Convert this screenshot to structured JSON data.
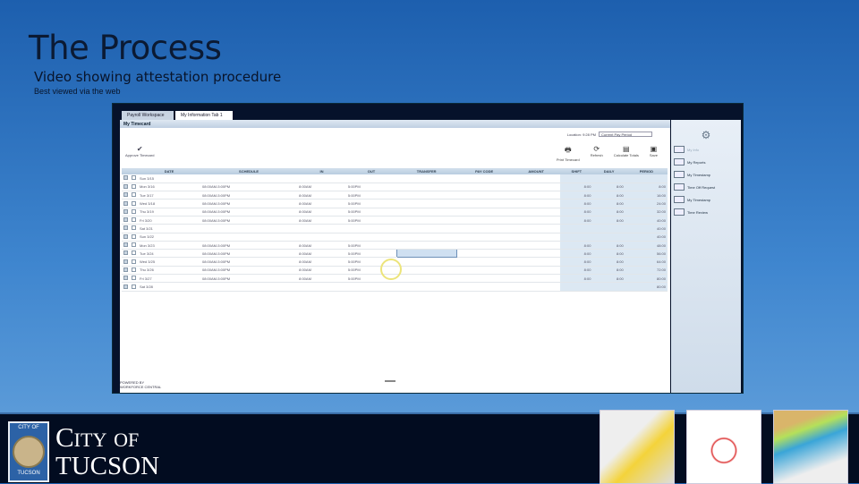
{
  "slide": {
    "title": "The Process",
    "subtitle": "Video showing attestation procedure",
    "note": "Best viewed via the web"
  },
  "app": {
    "tabs": [
      "Payroll Workspace",
      "My Information"
    ],
    "tab_close": "Tab 1",
    "header": "My Timecard",
    "location_label": "Location: 9:28 PM",
    "period_select": "Current Pay Period",
    "approve_label": "Approve Timecard",
    "tools": [
      {
        "icon": "print-icon",
        "label": "Print Timecard"
      },
      {
        "icon": "refresh-icon",
        "label": "Refresh"
      },
      {
        "icon": "calculate-icon",
        "label": "Calculate Totals"
      },
      {
        "icon": "save-icon",
        "label": "Save"
      }
    ],
    "columns": [
      "DATE",
      "SCHEDULE",
      "IN",
      "OUT",
      "TRANSFER",
      "PAY CODE",
      "AMOUNT",
      "SHIFT",
      "DAILY",
      "PERIOD"
    ],
    "rows": [
      [
        "Sun 3/15",
        "",
        "",
        "",
        "",
        "",
        "",
        "",
        "",
        ""
      ],
      [
        "Mon 3/16",
        "08:00AM-5:00PM",
        "8:00AM",
        "5:00PM",
        "",
        "",
        "",
        "8:00",
        "8:00",
        "8:00"
      ],
      [
        "Tue 3/17",
        "08:00AM-5:00PM",
        "8:00AM",
        "5:00PM",
        "",
        "",
        "",
        "8:00",
        "8:00",
        "16:00"
      ],
      [
        "Wed 3/18",
        "08:00AM-5:00PM",
        "8:00AM",
        "5:00PM",
        "",
        "",
        "",
        "8:00",
        "8:00",
        "24:00"
      ],
      [
        "Thu 3/19",
        "08:00AM-5:00PM",
        "8:00AM",
        "5:00PM",
        "",
        "",
        "",
        "8:00",
        "8:00",
        "32:00"
      ],
      [
        "Fri 3/20",
        "08:00AM-5:00PM",
        "8:00AM",
        "5:00PM",
        "",
        "",
        "",
        "8:00",
        "8:00",
        "40:00"
      ],
      [
        "Sat 3/21",
        "",
        "",
        "",
        "",
        "",
        "",
        "",
        "",
        "40:00"
      ],
      [
        "Sun 3/22",
        "",
        "",
        "",
        "",
        "",
        "",
        "",
        "",
        "40:00"
      ],
      [
        "Mon 3/23",
        "08:00AM-5:00PM",
        "8:00AM",
        "5:00PM",
        "",
        "",
        "",
        "8:00",
        "8:00",
        "48:00"
      ],
      [
        "Tue 3/24",
        "08:00AM-5:00PM",
        "8:00AM",
        "5:00PM",
        "",
        "",
        "",
        "8:00",
        "8:00",
        "56:00"
      ],
      [
        "Wed 3/25",
        "08:00AM-5:00PM",
        "8:00AM",
        "5:00PM",
        "",
        "",
        "",
        "8:00",
        "8:00",
        "64:00"
      ],
      [
        "Thu 3/26",
        "08:00AM-5:00PM",
        "8:00AM",
        "5:00PM",
        "",
        "",
        "",
        "8:00",
        "8:00",
        "72:00"
      ],
      [
        "Fri 3/27",
        "08:00AM-5:00PM",
        "8:00AM",
        "5:00PM",
        "",
        "",
        "",
        "8:00",
        "8:00",
        "80:00"
      ],
      [
        "Sat 3/28",
        "",
        "",
        "",
        "",
        "",
        "",
        "",
        "",
        "80:00"
      ]
    ],
    "powered_by": "POWERED BY",
    "powered_brand": "WORKFORCE CENTRAL",
    "sidebar": [
      "My Info",
      "My Reports",
      "My Timestamp",
      "Time Off Request",
      "My Timestamp",
      "Time Review"
    ]
  },
  "footer": {
    "logo_line1": "City of",
    "logo_line2": "Tucson",
    "seal_top": "CITY OF",
    "seal_bottom": "TUCSON"
  }
}
